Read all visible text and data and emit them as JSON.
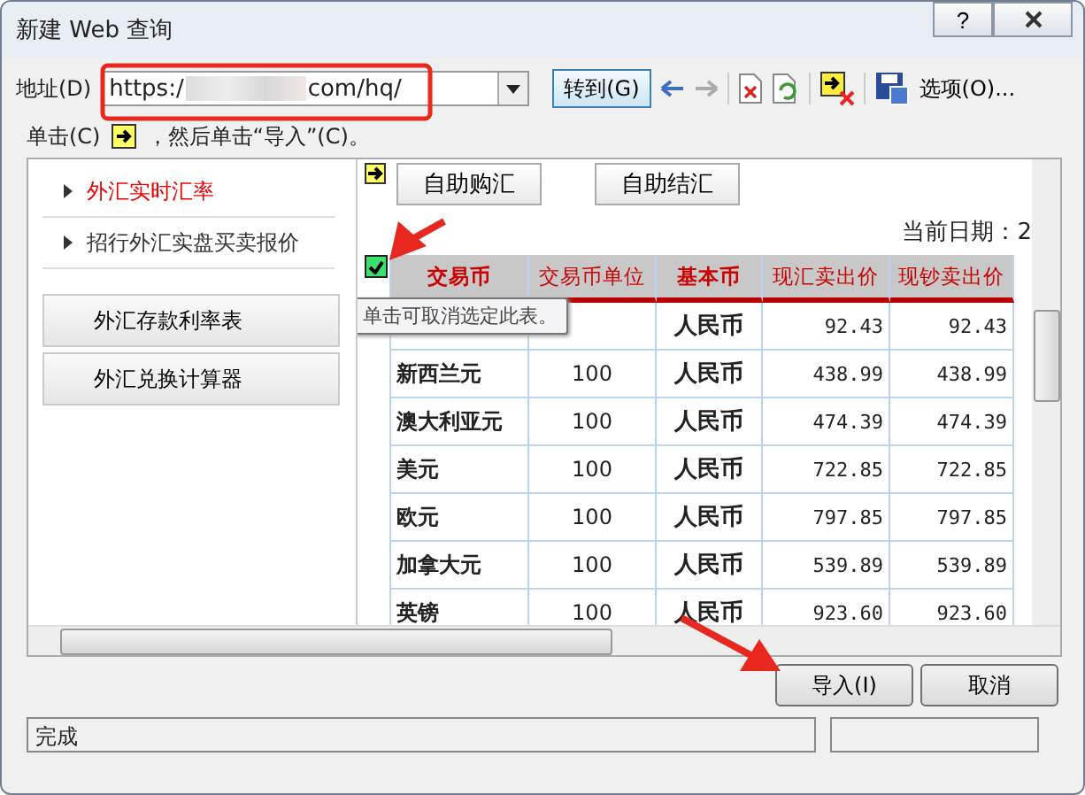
{
  "window": {
    "title": "新建 Web 查询",
    "help": "?"
  },
  "address": {
    "label": "地址(D)",
    "url_start": "https:/",
    "url_end": "com/hq/",
    "go": "转到(G)",
    "options": "选项(O)...",
    "back_disabled": false,
    "forward_disabled": true
  },
  "hint": {
    "before": "单击(C)",
    "after": "，然后单击“导入”(C)。"
  },
  "sidebar": {
    "links": [
      {
        "label": "外汇实时汇率",
        "selected": true
      },
      {
        "label": "招行外汇实盘买卖报价",
        "selected": false
      }
    ],
    "buttons": [
      "外汇存款利率表",
      "外汇兑换计算器"
    ]
  },
  "page": {
    "buttons": [
      "自助购汇",
      "自助结汇"
    ],
    "date": "当前日期：2",
    "table_checked": true,
    "tooltip": "单击可取消选定此表。"
  },
  "table": {
    "columns": [
      {
        "label": "交易币",
        "bold": true
      },
      {
        "label": "交易币单位",
        "bold": false
      },
      {
        "label": "基本币",
        "bold": true
      },
      {
        "label": "现汇卖出价",
        "bold": false
      },
      {
        "label": "现钞卖出价",
        "bold": false
      }
    ],
    "rows": [
      {
        "cells": [
          null,
          null,
          "人民币",
          "92.43",
          "92.43"
        ]
      },
      {
        "cells": [
          "新西兰元",
          "100",
          "人民币",
          "438.99",
          "438.99"
        ]
      },
      {
        "cells": [
          "澳大利亚元",
          "100",
          "人民币",
          "474.39",
          "474.39"
        ]
      },
      {
        "cells": [
          "美元",
          "100",
          "人民币",
          "722.85",
          "722.85"
        ]
      },
      {
        "cells": [
          "欧元",
          "100",
          "人民币",
          "797.85",
          "797.85"
        ]
      },
      {
        "cells": [
          "加拿大元",
          "100",
          "人民币",
          "539.89",
          "539.89"
        ]
      },
      {
        "cells": [
          "英镑",
          "100",
          "人民币",
          "923.60",
          "923.60"
        ]
      }
    ]
  },
  "footer": {
    "import": "导入(I)",
    "cancel": "取消"
  },
  "status_bar": {
    "text": "完成"
  }
}
